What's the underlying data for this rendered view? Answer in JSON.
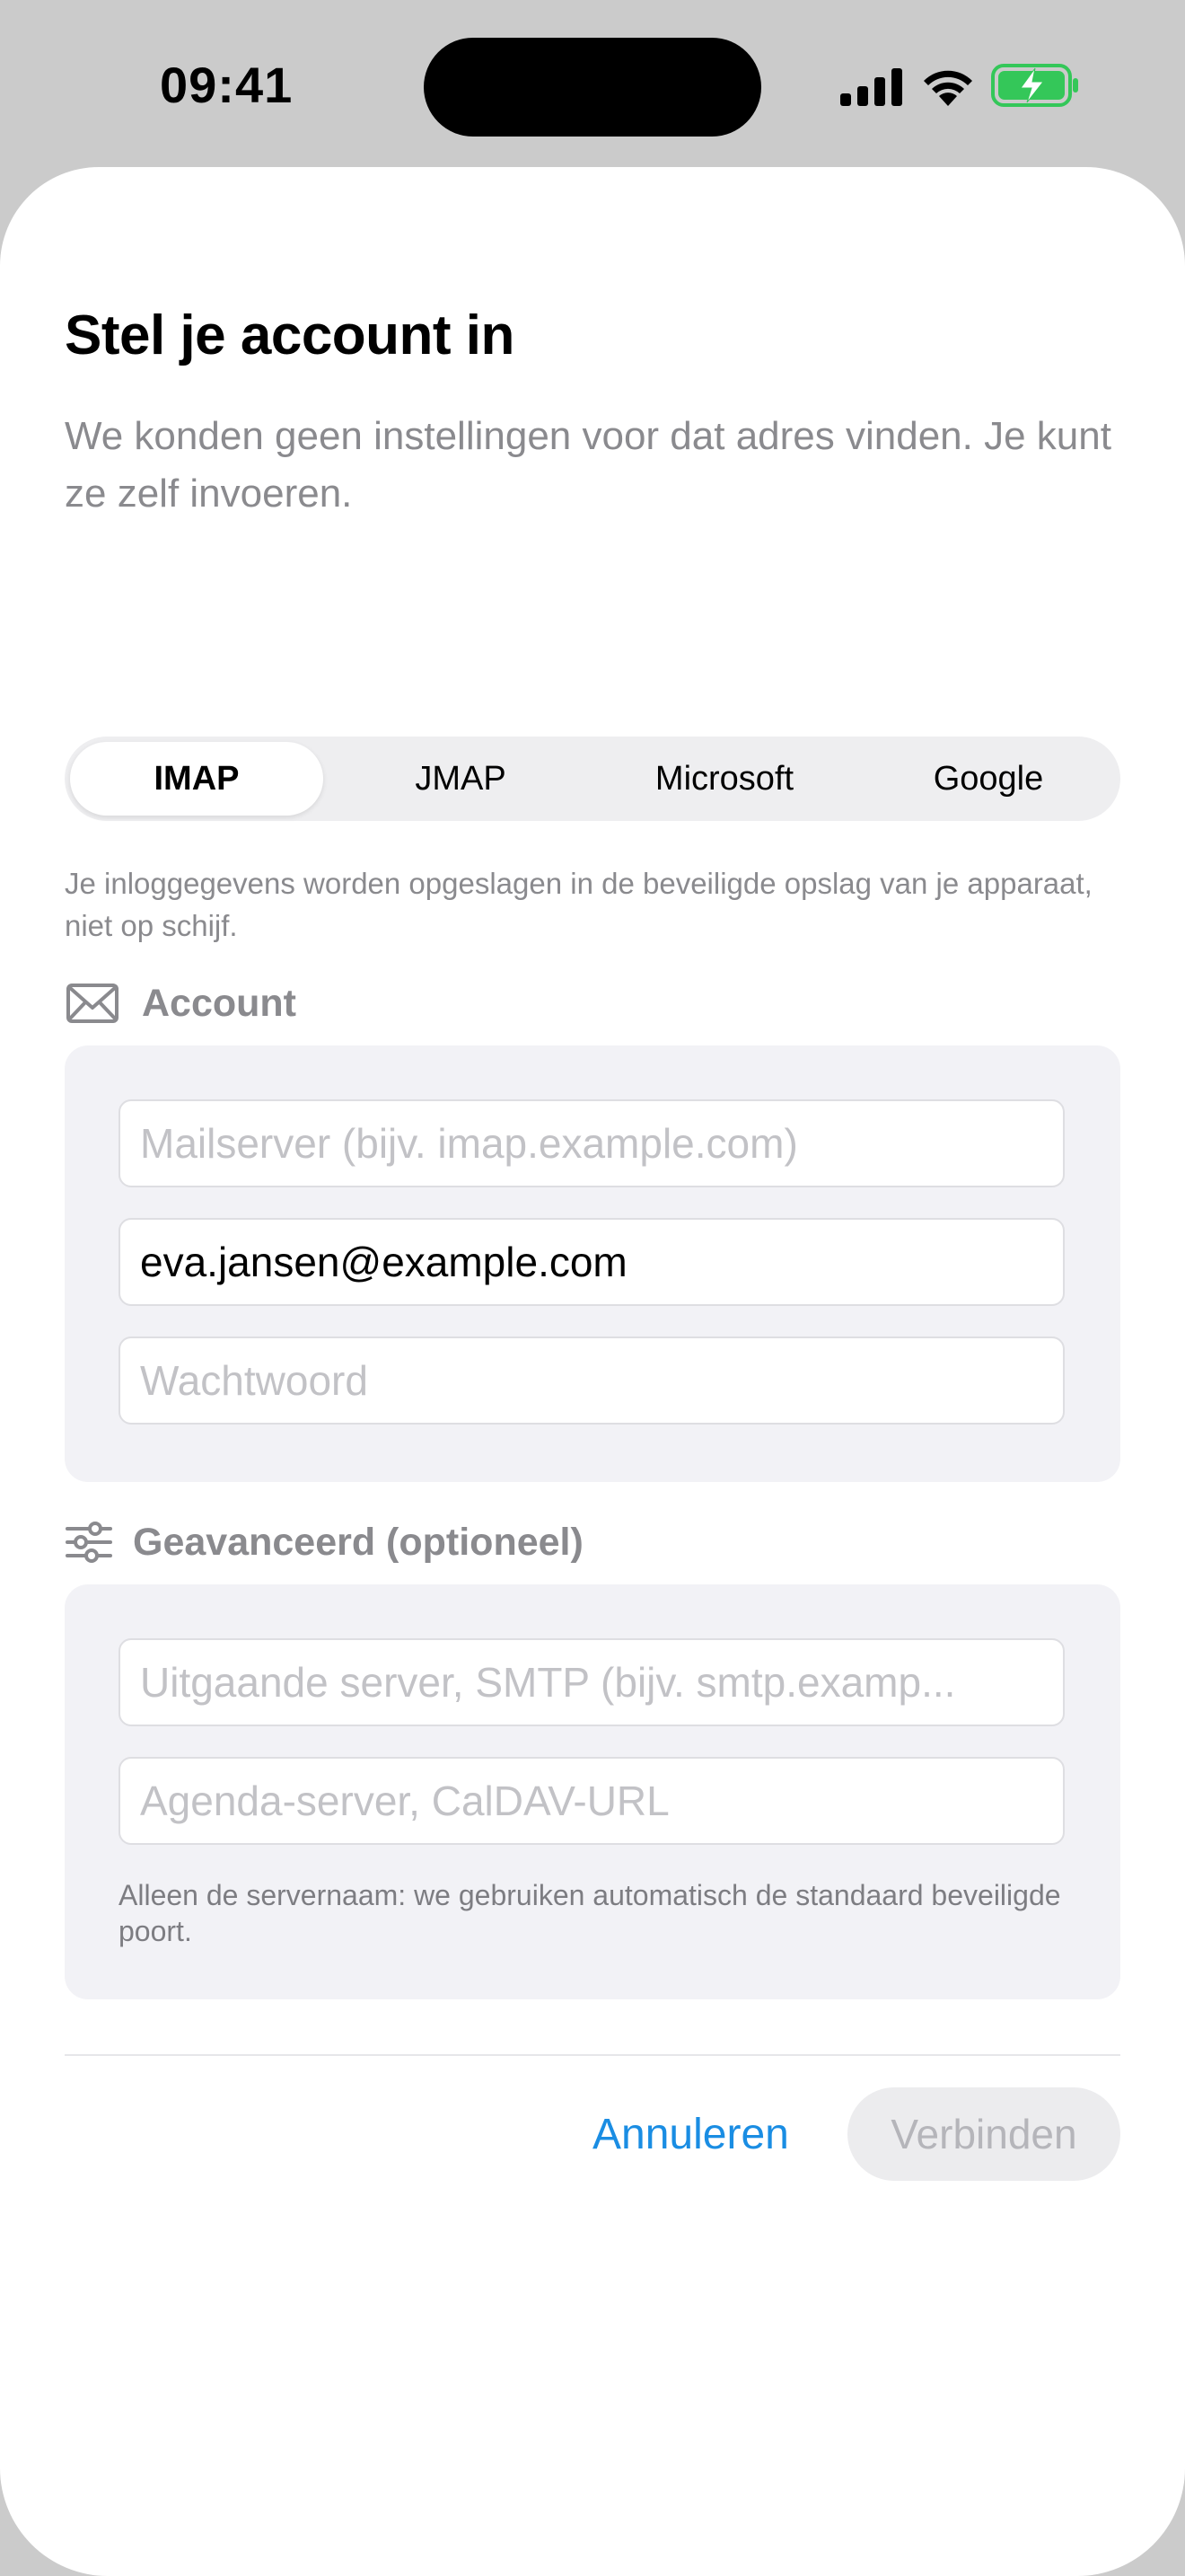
{
  "status_bar": {
    "time": "09:41",
    "icons": [
      "cellular-signal-icon",
      "wifi-icon",
      "battery-charging-icon"
    ],
    "battery_color": "#34c759"
  },
  "dialog": {
    "title": "Stel je account in",
    "subtitle": "We konden geen instellingen voor dat adres vinden. Je kunt ze zelf invoeren.",
    "tabs": [
      {
        "label": "IMAP",
        "selected": true
      },
      {
        "label": "JMAP",
        "selected": false
      },
      {
        "label": "Microsoft",
        "selected": false
      },
      {
        "label": "Google",
        "selected": false
      }
    ],
    "credentials_note": "Je inloggegevens worden opgeslagen in de beveiligde opslag van je apparaat, niet op schijf."
  },
  "account_section": {
    "header": "Account",
    "icon": "envelope-icon",
    "mail_server": {
      "value": "",
      "placeholder": "Mailserver (bijv. imap.example.com)"
    },
    "email": {
      "value": "eva.jansen@example.com",
      "placeholder": ""
    },
    "password": {
      "value": "",
      "placeholder": "Wachtwoord"
    }
  },
  "advanced_section": {
    "header": "Geavanceerd (optioneel)",
    "icon": "sliders-icon",
    "smtp_server": {
      "value": "",
      "placeholder": "Uitgaande server, SMTP (bijv. smtp.examp..."
    },
    "caldav_server": {
      "value": "",
      "placeholder": "Agenda-server, CalDAV-URL"
    },
    "note": "Alleen de servernaam: we gebruiken automatisch de standaard beveiligde poort."
  },
  "actions": {
    "cancel_label": "Annuleren",
    "connect_label": "Verbinden",
    "connect_enabled": false,
    "accent_color": "#1a8de3"
  }
}
